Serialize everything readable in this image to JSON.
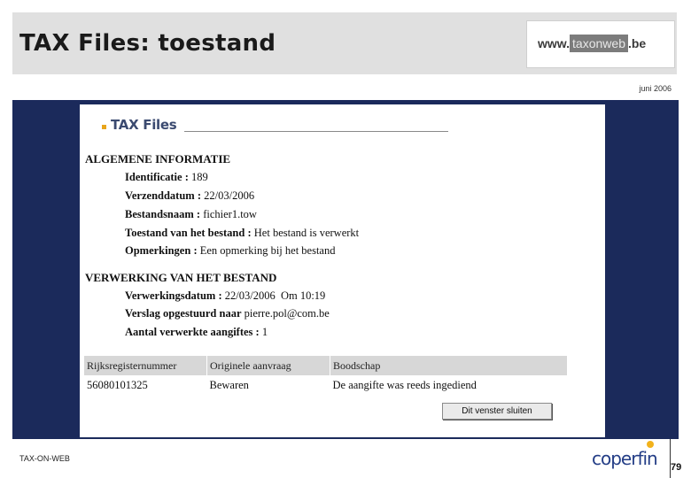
{
  "slide": {
    "title": "TAX Files: toestand",
    "date": "juni 2006",
    "footer_text": "TAX-ON-WEB",
    "page_number": "79",
    "logo": {
      "prefix": "www.",
      "middle": "taxonweb",
      "suffix": ".be"
    },
    "footer_logo": "coperfin"
  },
  "window": {
    "header": "TAX Files",
    "general": {
      "title": "ALGEMENE INFORMATIE",
      "fields": [
        {
          "label": "Identificatie",
          "value": "189"
        },
        {
          "label": "Verzenddatum",
          "value": "22/03/2006"
        },
        {
          "label": "Bestandsnaam",
          "value": "fichier1.tow"
        },
        {
          "label": "Toestand van het bestand",
          "value": "Het bestand is verwerkt"
        },
        {
          "label": "Opmerkingen",
          "value": "Een opmerking bij het bestand"
        }
      ]
    },
    "processing": {
      "title": "VERWERKING VAN HET BESTAND",
      "processing_date_label": "Verwerkingsdatum",
      "processing_date_value": "22/03/2006",
      "processing_time_label": "Om",
      "processing_time_value": "10:19",
      "report_label": "Verslag opgestuurd naar",
      "report_value": "pierre.pol@com.be",
      "count_label": "Aantal verwerkte aangiftes",
      "count_value": "1"
    },
    "table": {
      "columns": [
        "Rijksregisternummer",
        "Originele aanvraag",
        "Boodschap"
      ],
      "rows": [
        [
          "56080101325",
          "Bewaren",
          "De aangifte was reeds ingediend"
        ]
      ]
    },
    "close_button": "Dit venster sluiten"
  },
  "colors": {
    "frame": "#1b2a5b",
    "accent": "#e8a51b",
    "header_bar": "#e0e0e0",
    "table_header": "#d7d7d7"
  }
}
